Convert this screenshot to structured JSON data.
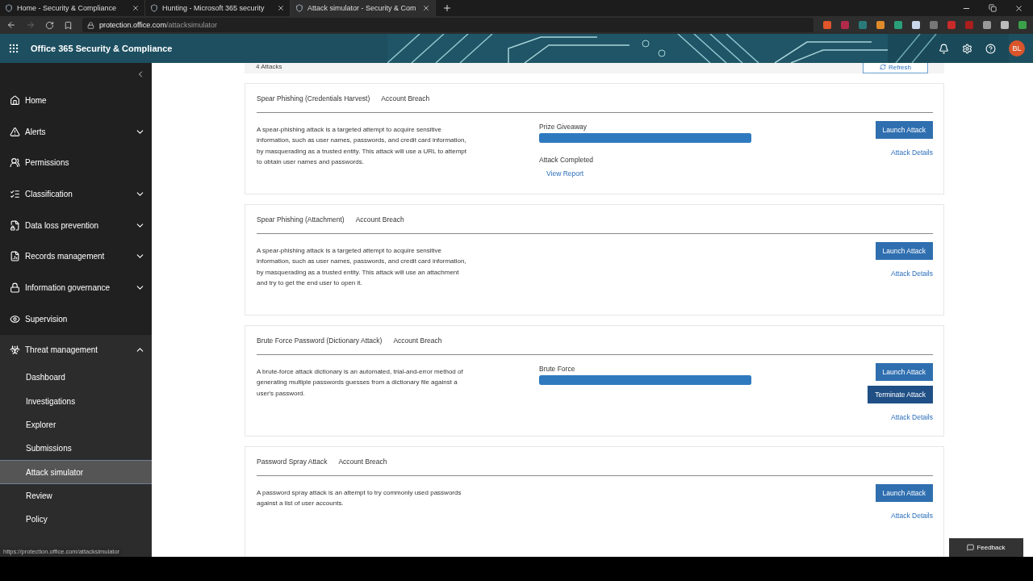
{
  "browser": {
    "tabs": [
      {
        "title": "Home - Security & Compliance",
        "selected": false
      },
      {
        "title": "Hunting - Microsoft 365 security",
        "selected": false
      },
      {
        "title": "Attack simulator - Security & Com",
        "selected": true
      }
    ],
    "url": {
      "domain": "protection.office.com",
      "path": "/attacksimulator"
    },
    "status_url": "https://protection.office.com/attacksimulator"
  },
  "app": {
    "title": "Office 365 Security & Compliance",
    "avatar": "BL"
  },
  "sidebar": {
    "items": [
      {
        "label": "Home"
      },
      {
        "label": "Alerts",
        "expanded": false
      },
      {
        "label": "Permissions"
      },
      {
        "label": "Classification",
        "expanded": false
      },
      {
        "label": "Data loss prevention",
        "expanded": false
      },
      {
        "label": "Records management",
        "expanded": false
      },
      {
        "label": "Information governance",
        "expanded": false
      },
      {
        "label": "Supervision"
      },
      {
        "label": "Threat management",
        "expanded": true,
        "children": [
          {
            "label": "Dashboard",
            "selected": false
          },
          {
            "label": "Investigations",
            "selected": false
          },
          {
            "label": "Explorer",
            "selected": false
          },
          {
            "label": "Submissions",
            "selected": false
          },
          {
            "label": "Attack simulator",
            "selected": true
          },
          {
            "label": "Review",
            "selected": false
          },
          {
            "label": "Policy",
            "selected": false
          }
        ]
      }
    ]
  },
  "summary": {
    "count": "4 Attacks",
    "refresh": "Refresh"
  },
  "attacks": [
    {
      "name": "Spear Phishing (Credentials Harvest)",
      "category": "Account Breach",
      "description": "A spear-phishing attack is a targeted attempt to acquire sensitive information, such as user names, passwords, and credit card information, by masquerading as a trusted entity. This attack will use a URL to attempt to obtain user names and passwords.",
      "progress": {
        "label": "Prize Giveaway",
        "level": 1,
        "status": "Attack Completed",
        "link": "View Report"
      },
      "buttons": [
        {
          "label": "Launch Attack",
          "kind": "primary"
        }
      ],
      "details": "Attack Details"
    },
    {
      "name": "Spear Phishing (Attachment)",
      "category": "Account Breach",
      "description": "A spear-phishing attack is a targeted attempt to acquire sensitive information, such as user names, passwords, and credit card information, by masquerading as a trusted entity. This attack will use an attachment and try to get the end user to open it.",
      "buttons": [
        {
          "label": "Launch Attack",
          "kind": "primary"
        }
      ],
      "details": "Attack Details"
    },
    {
      "name": "Brute Force Password (Dictionary Attack)",
      "category": "Account Breach",
      "description": "A brute-force attack dictionary is an automated, trial-and-error method of generating multiple passwords guesses from a dictionary file against a user's password.",
      "progress": {
        "label": "Brute Force",
        "level": 1
      },
      "buttons": [
        {
          "label": "Launch Attack",
          "kind": "primary"
        },
        {
          "label": "Terminate Attack",
          "kind": "hover"
        }
      ],
      "details": "Attack Details"
    },
    {
      "name": "Password Spray Attack",
      "category": "Account Breach",
      "description": "A password spray attack is an attempt to try commonly used passwords against a list of user accounts.",
      "buttons": [
        {
          "label": "Launch Attack",
          "kind": "primary"
        }
      ],
      "details": "Attack Details"
    }
  ],
  "feedback": "Feedback"
}
